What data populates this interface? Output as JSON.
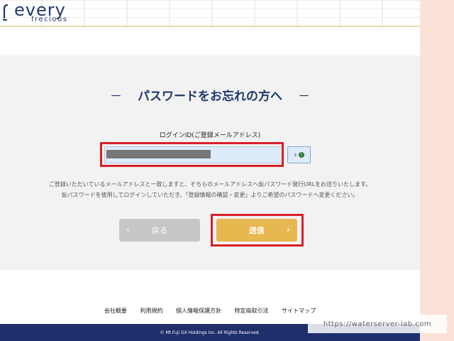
{
  "header": {
    "logo_main": "every",
    "logo_sub": "frecious"
  },
  "form": {
    "title": "パスワードをお忘れの方へ",
    "title_dash_left": "－",
    "title_dash_right": "－",
    "field_label": "ログインID(ご登録メールアドレス)",
    "input_value": "",
    "reveal_button_label": "›",
    "description_line1": "ご登録いただいているメールアドレスと一致しますと、そちらのメールアドレスへ仮パスワード発行URLをお送りいたします。",
    "description_line2": "仮パスワードを使用してログインしていただき、「登録情報の確認・変更」よりご希望のパスワードへ変更ください。",
    "back_button_label": "戻る",
    "send_button_label": "送信"
  },
  "footer": {
    "links": [
      "会社概要",
      "利用規約",
      "個人情報保護方針",
      "特定商取引法",
      "サイトマップ"
    ],
    "copyright": "© Mt.Fuji GX Holdings Inc. All Rights Reserved."
  },
  "watermark": "https://waterserver-lab.com",
  "colors": {
    "brand_navy": "#1f3a6b",
    "send_button": "#e6b84f",
    "back_button": "#c7c7c7",
    "highlight_red": "#d91f2a",
    "footer_bar": "#1f2f6b"
  }
}
